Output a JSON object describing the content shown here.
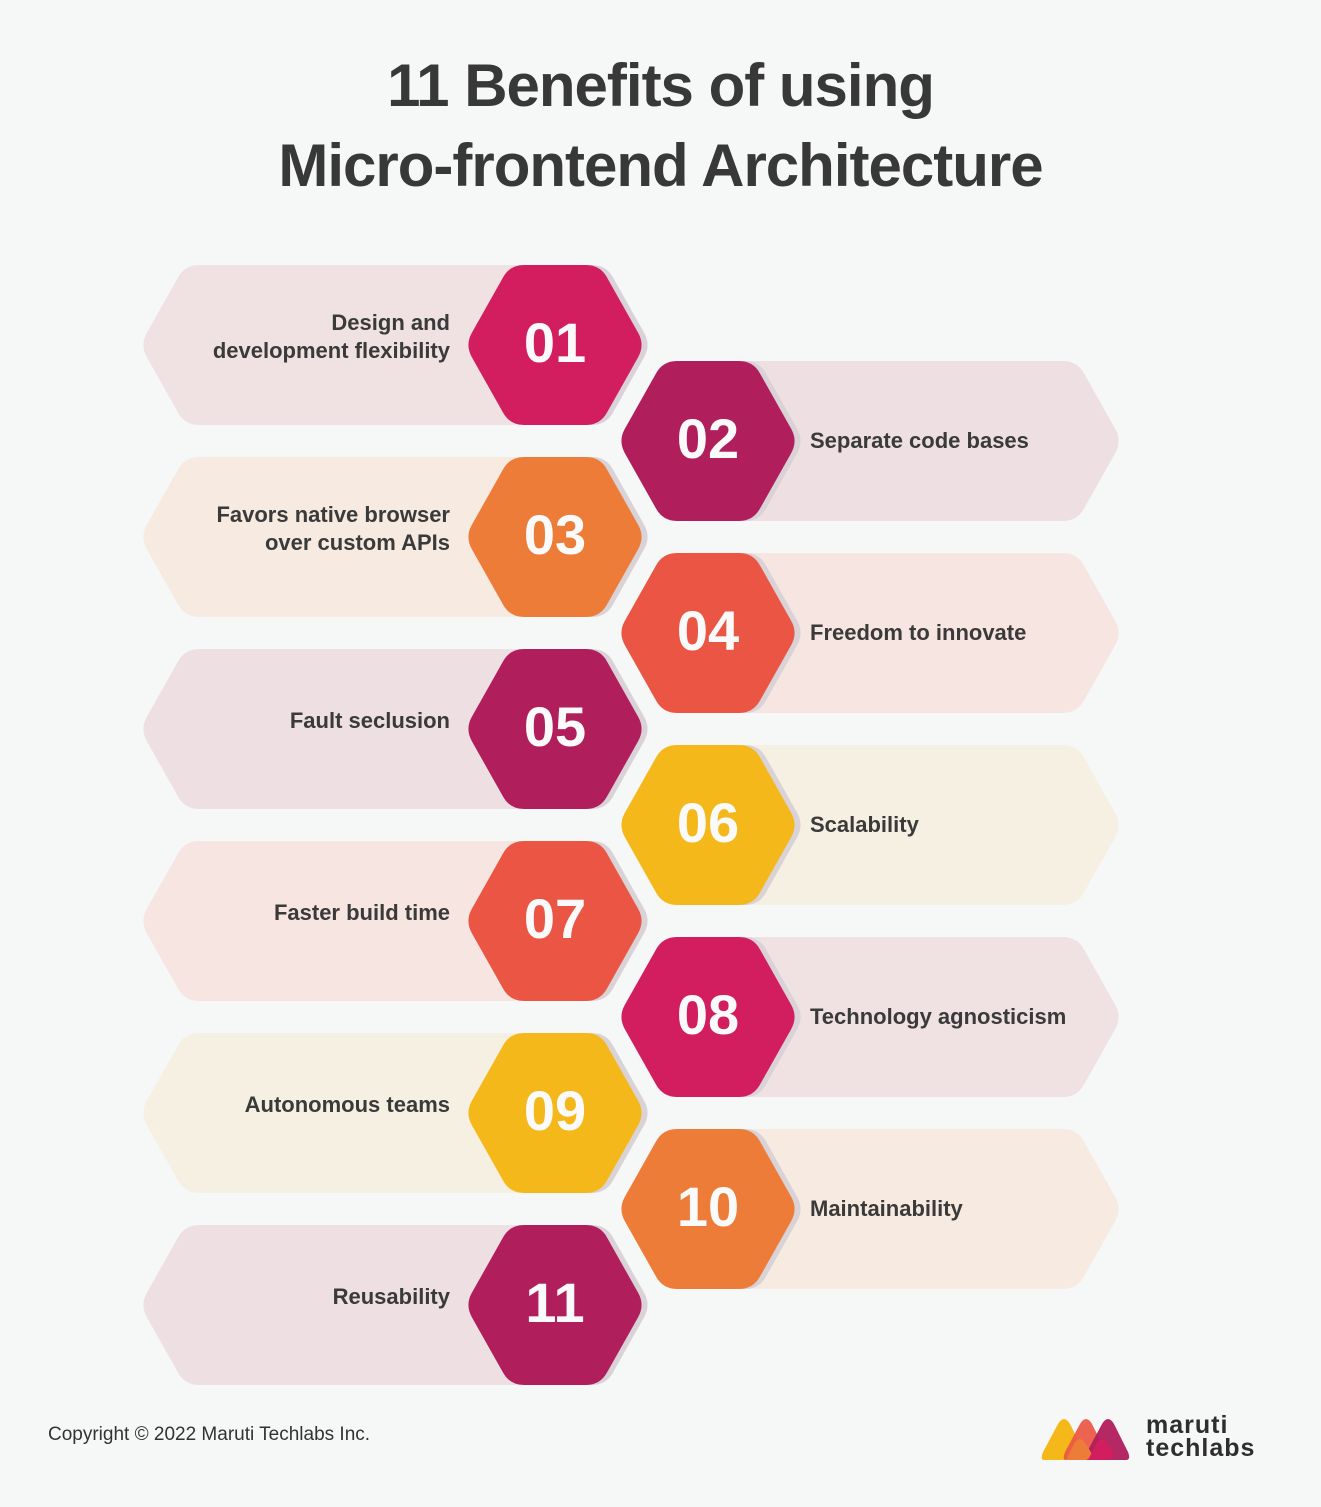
{
  "title": {
    "line1": "11 Benefits of using",
    "line2": "Micro-frontend Architecture"
  },
  "benefits": [
    {
      "number": "01",
      "label": "Design and development flexibility",
      "lines": [
        "Design and",
        "development flexibility"
      ],
      "side": "left",
      "color": "#d21d5e",
      "band_color": "#f0e1e3"
    },
    {
      "number": "02",
      "label": "Separate code bases",
      "lines": [
        "Separate code bases"
      ],
      "side": "right",
      "color": "#b01e5c",
      "band_color": "#eedfe2"
    },
    {
      "number": "03",
      "label": "Favors native browser over custom APIs",
      "lines": [
        "Favors native browser",
        "over custom APIs"
      ],
      "side": "left",
      "color": "#ec7c38",
      "band_color": "#f6eae1"
    },
    {
      "number": "04",
      "label": "Freedom to innovate",
      "lines": [
        "Freedom to innovate"
      ],
      "side": "right",
      "color": "#ea5643",
      "band_color": "#f6e5e0"
    },
    {
      "number": "05",
      "label": "Fault seclusion",
      "lines": [
        "Fault seclusion"
      ],
      "side": "left",
      "color": "#b01e5c",
      "band_color": "#eedfe2"
    },
    {
      "number": "06",
      "label": "Scalability",
      "lines": [
        "Scalability"
      ],
      "side": "right",
      "color": "#f5b81a",
      "band_color": "#f6f0e2"
    },
    {
      "number": "07",
      "label": "Faster build time",
      "lines": [
        "Faster build time"
      ],
      "side": "left",
      "color": "#ea5643",
      "band_color": "#f6e5e0"
    },
    {
      "number": "08",
      "label": "Technology agnosticism",
      "lines": [
        "Technology agnosticism"
      ],
      "side": "right",
      "color": "#d21d5e",
      "band_color": "#f0e1e3"
    },
    {
      "number": "09",
      "label": "Autonomous teams",
      "lines": [
        "Autonomous teams"
      ],
      "side": "left",
      "color": "#f5b81a",
      "band_color": "#f6f0e2"
    },
    {
      "number": "10",
      "label": "Maintainability",
      "lines": [
        "Maintainability"
      ],
      "side": "right",
      "color": "#ec7c38",
      "band_color": "#f6eae1"
    },
    {
      "number": "11",
      "label": "Reusability",
      "lines": [
        "Reusability"
      ],
      "side": "left",
      "color": "#b01e5c",
      "band_color": "#eedfe2"
    }
  ],
  "footer": {
    "copyright": "Copyright © 2022 Maruti Techlabs Inc.",
    "logo_line1": "maruti",
    "logo_line2": "techlabs",
    "logo_colors": [
      "#f5b81a",
      "#ec7c38",
      "#ea5643",
      "#d21d5e",
      "#b01e5c"
    ]
  }
}
